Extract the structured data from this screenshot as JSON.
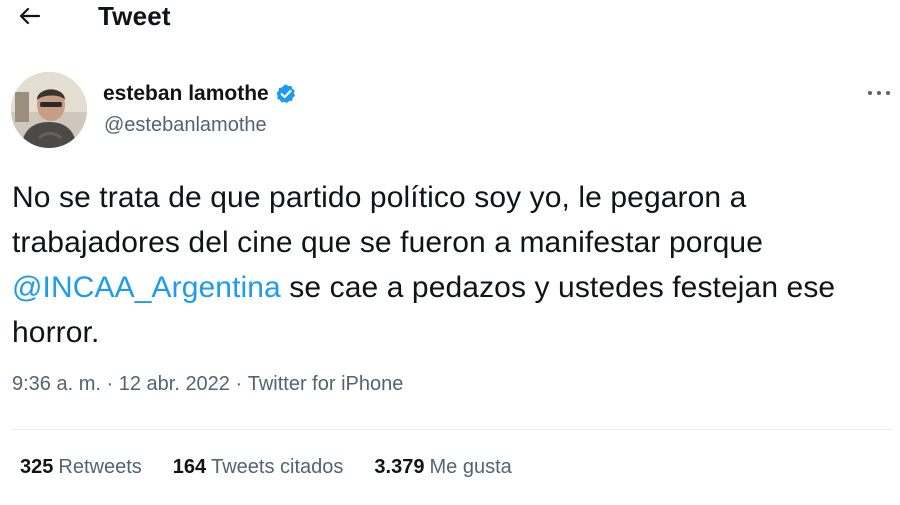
{
  "header": {
    "title": "Tweet"
  },
  "author": {
    "name": "esteban lamothe",
    "handle": "@estebanlamothe",
    "verified": true
  },
  "tweet": {
    "text_before": "No se trata de que partido político soy yo, le pegaron a trabajadores del cine que se fueron a manifestar porque ",
    "mention": "@INCAA_Argentina",
    "text_after": " se cae a pedazos y ustedes festejan ese horror."
  },
  "meta": {
    "time": "9:36 a. m.",
    "separator1": " · ",
    "date": "12 abr. 2022",
    "separator2": " · ",
    "source": "Twitter for iPhone"
  },
  "stats": [
    {
      "count": "325",
      "label": "Retweets"
    },
    {
      "count": "164",
      "label": "Tweets citados"
    },
    {
      "count": "3.379",
      "label": "Me gusta"
    }
  ],
  "colors": {
    "accent": "#1d9bf0",
    "text": "#0f1419",
    "secondary": "#536471",
    "divider": "#e6ecf0"
  },
  "icons": {
    "back": "arrow-left-icon",
    "verified": "verified-badge-icon",
    "more": "more-horizontal-icon"
  }
}
